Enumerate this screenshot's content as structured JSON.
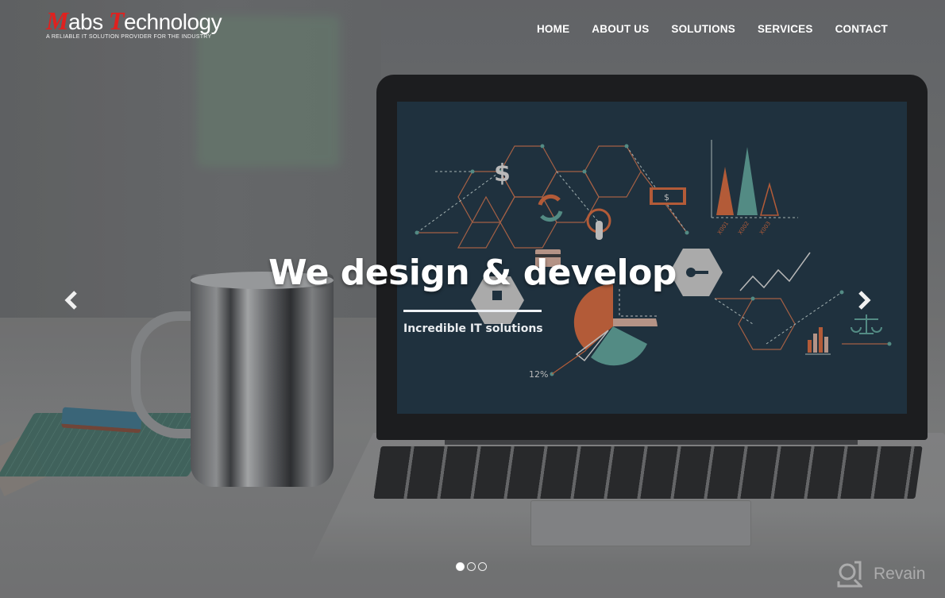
{
  "header": {
    "logo": {
      "initial1": "M",
      "part1": "abs ",
      "initial2": "T",
      "part2": "echnology",
      "tagline": "A reliable IT solution provider for the industry"
    },
    "nav": [
      {
        "label": "HOME"
      },
      {
        "label": "ABOUT US"
      },
      {
        "label": "SOLUTIONS"
      },
      {
        "label": "SERVICES"
      },
      {
        "label": "CONTACT"
      }
    ]
  },
  "carousel": {
    "title": "We design & develop",
    "subtitle": "Incredible IT solutions",
    "prev_icon": "chevron-left-icon",
    "next_icon": "chevron-right-icon",
    "slide_count": 3,
    "active_slide": 1,
    "screen_art": {
      "percent_label": "12%",
      "bar_labels": [
        "X001",
        "X002",
        "X003"
      ]
    }
  },
  "watermark": {
    "text": "Revain"
  },
  "colors": {
    "brand_red": "#e0211f",
    "text_white": "#ffffff",
    "screen_bg": "#1f3442",
    "accent_orange": "#c8643c",
    "accent_teal": "#5a9a92"
  }
}
